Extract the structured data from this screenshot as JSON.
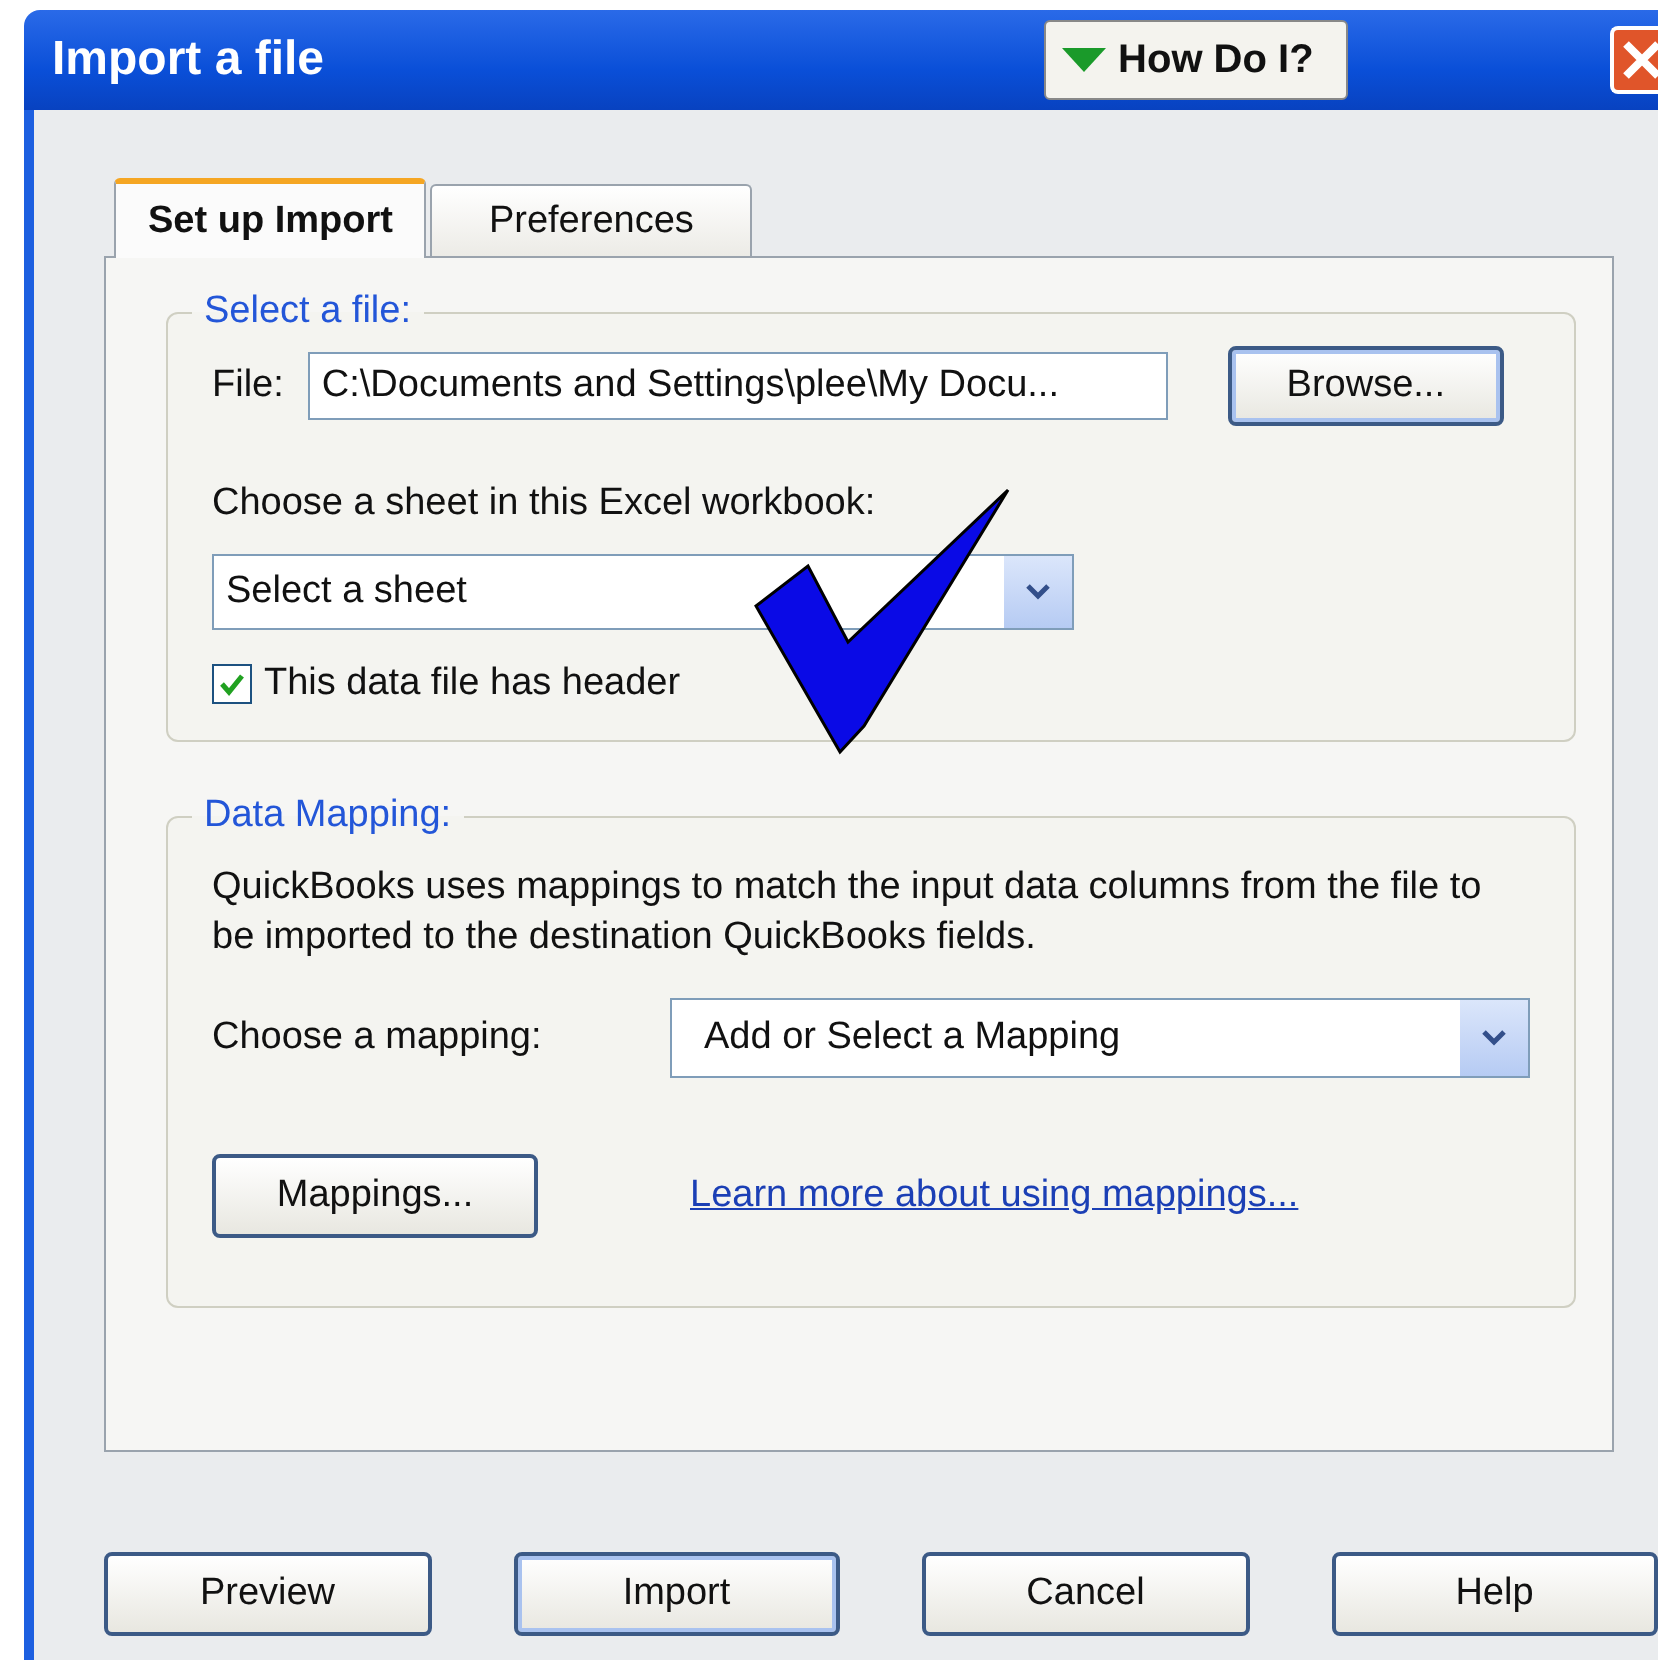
{
  "window": {
    "title": "Import a file",
    "help_button": "How Do I?"
  },
  "tabs": [
    {
      "label": "Set up Import",
      "selected": true
    },
    {
      "label": "Preferences",
      "selected": false
    }
  ],
  "select_file": {
    "legend": "Select a file:",
    "file_label": "File:",
    "file_value": "C:\\Documents and Settings\\plee\\My Docu...",
    "browse_button": "Browse...",
    "sheet_label": "Choose a sheet in this Excel workbook:",
    "sheet_value": "Select a sheet",
    "header_checkbox": {
      "label": "This data file has header",
      "checked": true
    }
  },
  "data_mapping": {
    "legend": "Data Mapping:",
    "description": "QuickBooks uses mappings to match the input data columns from the file to be imported to the destination QuickBooks fields.",
    "mapping_label": "Choose a mapping:",
    "mapping_value": "Add or Select a Mapping",
    "mappings_button": "Mappings...",
    "learn_link": "Learn more about using mappings..."
  },
  "buttons": [
    {
      "label": "Preview",
      "default": false
    },
    {
      "label": "Import",
      "default": true
    },
    {
      "label": "Cancel",
      "default": false
    },
    {
      "label": "Help",
      "default": false
    }
  ]
}
